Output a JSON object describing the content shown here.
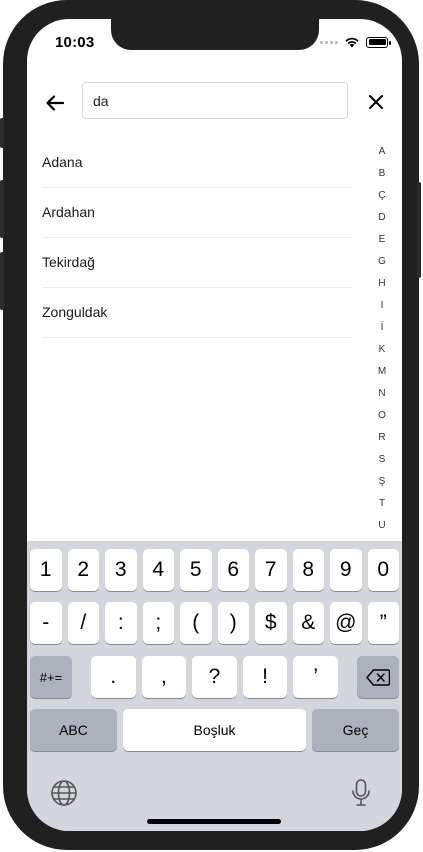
{
  "status_bar": {
    "time": "10:03"
  },
  "search": {
    "value": "da",
    "placeholder": ""
  },
  "icons": {
    "back": "arrow-left-icon",
    "close": "close-icon",
    "globe": "globe-icon",
    "mic": "microphone-icon",
    "backspace": "backspace-icon",
    "wifi": "wifi-icon",
    "battery": "battery-icon"
  },
  "results": [
    "Adana",
    "Ardahan",
    "Tekirdağ",
    "Zonguldak"
  ],
  "index_letters": [
    "A",
    "B",
    "Ç",
    "D",
    "E",
    "G",
    "H",
    "I",
    "İ",
    "K",
    "M",
    "N",
    "O",
    "R",
    "S",
    "Ş",
    "T",
    "U"
  ],
  "keyboard": {
    "row1": [
      "1",
      "2",
      "3",
      "4",
      "5",
      "6",
      "7",
      "8",
      "9",
      "0"
    ],
    "row2": [
      "-",
      "/",
      ":",
      ";",
      "(",
      ")",
      "$",
      "&",
      "@",
      "”"
    ],
    "row3_mode": "#+=",
    "row3": [
      ".",
      ",",
      "?",
      "!",
      "’"
    ],
    "abc": "ABC",
    "space": "Boşluk",
    "go": "Geç"
  },
  "colors": {
    "frame": "#202020",
    "keyboard_bg": "#d3d6dd",
    "key": "#ffffff",
    "key_dark": "#acb1bb"
  }
}
